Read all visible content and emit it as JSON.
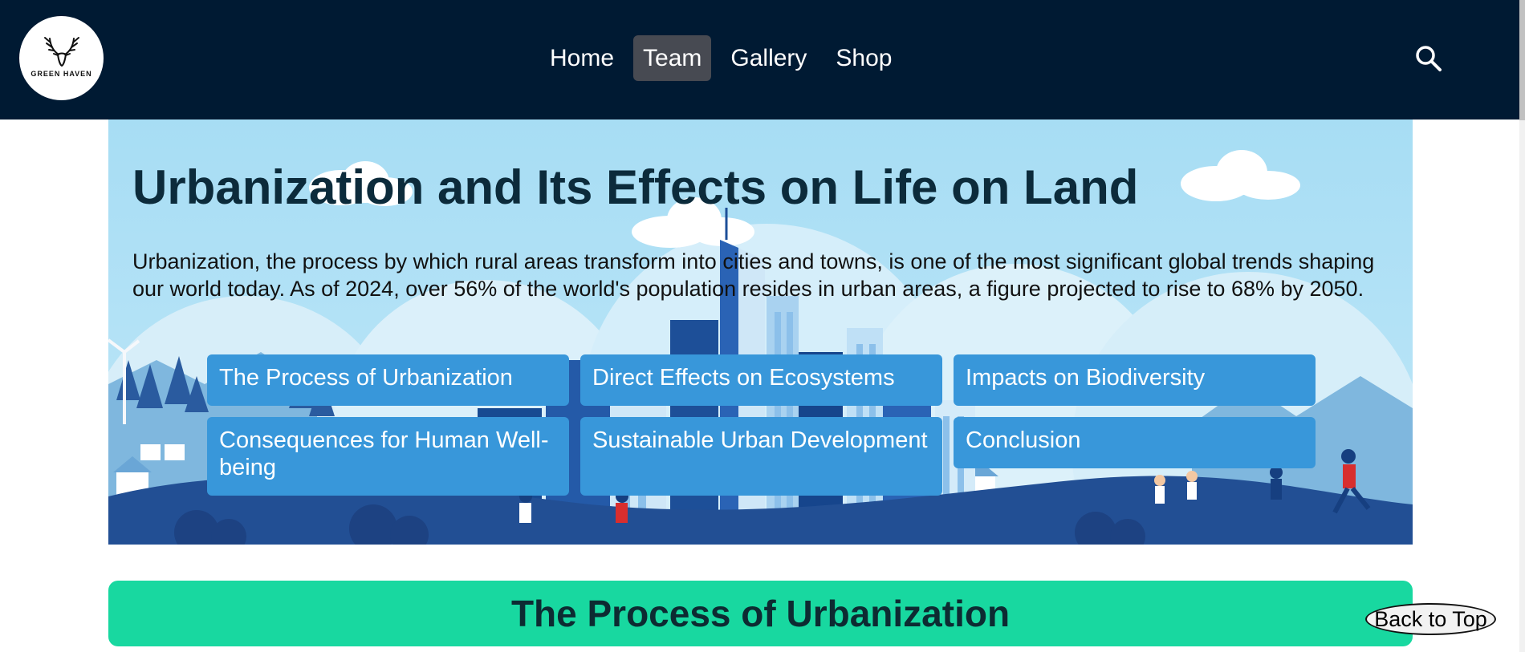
{
  "brand": {
    "logo_text": "GREEN HAVEN",
    "logo_icon": "stag-antlers-icon"
  },
  "nav": {
    "items": [
      {
        "label": "Home",
        "active": false
      },
      {
        "label": "Team",
        "active": true
      },
      {
        "label": "Gallery",
        "active": false
      },
      {
        "label": "Shop",
        "active": false
      }
    ],
    "search_icon": "search-icon"
  },
  "hero": {
    "title": "Urbanization and Its Effects on Life on Land",
    "intro": "Urbanization, the process by which rural areas transform into cities and towns, is one of the most significant global trends shaping our world today. As of 2024, over 56% of the world's population resides in urban areas, a figure projected to rise to 68% by 2050.",
    "topics": [
      "The Process of Urbanization",
      "Direct Effects on Ecosystems",
      "Impacts on Biodiversity",
      "Consequences for Human Well-being",
      "Sustainable Urban Development",
      "Conclusion"
    ]
  },
  "section": {
    "title": "The Process of Urbanization"
  },
  "back_to_top": "Back to Top",
  "colors": {
    "navbar_bg": "#001a33",
    "nav_active_bg": "#474a52",
    "topic_button_bg": "#3897da",
    "section_bar_bg": "#18d8a0",
    "hero_sky": "#a9dff5"
  }
}
